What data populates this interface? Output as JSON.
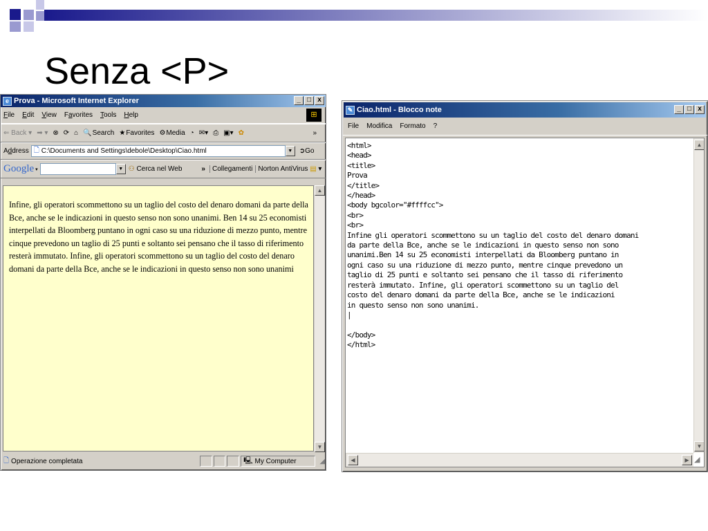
{
  "slide": {
    "title": "Senza <P>"
  },
  "ie": {
    "title": "Prova - Microsoft Internet Explorer",
    "controls": [
      "_",
      "□",
      "x"
    ],
    "menu": [
      {
        "label": "File",
        "key": "F",
        "rest": "ile"
      },
      {
        "label": "Edit",
        "key": "E",
        "rest": "dit"
      },
      {
        "label": "View",
        "key": "V",
        "rest": "iew"
      },
      {
        "label": "Favorites",
        "pre": "F",
        "key": "a",
        "rest": "vorites"
      },
      {
        "label": "Tools",
        "key": "T",
        "rest": "ools"
      },
      {
        "label": "Help",
        "key": "H",
        "rest": "elp"
      }
    ],
    "toolbar": {
      "back": "⇐ Back ▾",
      "forward": "➡ ▾",
      "search": "Search",
      "favorites": "Favorites",
      "media": "Media"
    },
    "address": {
      "label_pre": "A",
      "label_key": "d",
      "label_rest": "dress",
      "value": "C:\\Documents and Settings\\debole\\Desktop\\Ciao.html",
      "go": "Go"
    },
    "google": {
      "logo": "Google",
      "search_button": "Cerca nel Web",
      "links": "Collegamenti",
      "antivirus": "Norton AntiVirus"
    },
    "content": "Infine, gli operatori scommettono su un taglio del costo del denaro domani da parte della Bce, anche se le indicazioni in questo senso non sono unanimi. Ben 14 su 25 economisti interpellati da Bloomberg puntano in ogni caso su una riduzione di mezzo punto, mentre cinque prevedono un taglio di 25 punti e soltanto sei pensano che il tasso di riferimento resterà immutato. Infine, gli operatori scommettono su un taglio del costo del denaro domani da parte della Bce, anche se le indicazioni in questo senso non sono unanimi",
    "status": {
      "text": "Operazione completata",
      "zone": "My Computer"
    }
  },
  "notepad": {
    "title": "Ciao.html - Blocco note",
    "controls": [
      "_",
      "□",
      "x"
    ],
    "menu": [
      "File",
      "Modifica",
      "Formato",
      "?"
    ],
    "lines": [
      "<html>",
      "<head>",
      "<title>",
      "Prova",
      "</title>",
      "</head>",
      "<body bgcolor=\"#ffffcc\">",
      "<br>",
      "<br>",
      "Infine gli operatori scommettono su un taglio del costo del denaro domani",
      "da parte della Bce, anche se le indicazioni in questo senso non sono",
      "unanimi.Ben 14 su 25 economisti interpellati da Bloomberg puntano in",
      "ogni caso su una riduzione di mezzo punto, mentre cinque prevedono un",
      "taglio di 25 punti e soltanto sei pensano che il tasso di riferimento",
      "resterà immutato. Infine, gli operatori scommettono su un taglio del",
      "costo del denaro domani da parte della Bce, anche se le indicazioni",
      "in questo senso non sono unanimi.",
      "|",
      "",
      "</body>",
      "</html>"
    ]
  },
  "colors": {
    "titlebar": "#0a246a",
    "page_bg": "#ffffcc",
    "window": "#d4d0c8"
  }
}
